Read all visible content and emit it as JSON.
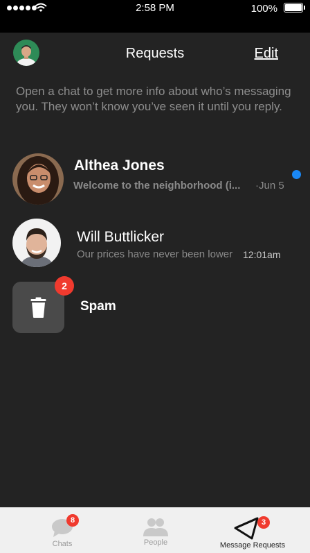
{
  "status_bar": {
    "time": "2:58 PM",
    "battery": "100%"
  },
  "header": {
    "title": "Requests",
    "edit_label": "Edit"
  },
  "info_text": "Open a chat to get more info about who’s messaging you. They won’t know you’ve seen it until you reply.",
  "requests": [
    {
      "name": "Althea Jones",
      "preview": "Welcome to the neighborhood (i...",
      "time": "·Jun 5",
      "unread": true
    },
    {
      "name": "Will Buttlicker",
      "preview": "Our prices have never been lower",
      "time": "12:01am",
      "unread": false
    }
  ],
  "spam": {
    "label": "Spam",
    "count": "2"
  },
  "tabs": [
    {
      "label": "Chats",
      "badge": "8",
      "icon": "chat-bubble-icon",
      "active": false
    },
    {
      "label": "People",
      "badge": "",
      "icon": "people-icon",
      "active": false
    },
    {
      "label": "Message Requests",
      "badge": "3",
      "icon": "paper-plane-icon",
      "active": true
    }
  ],
  "colors": {
    "background": "#232323",
    "accent": "#1a88f5",
    "badge": "#f03a2e"
  }
}
